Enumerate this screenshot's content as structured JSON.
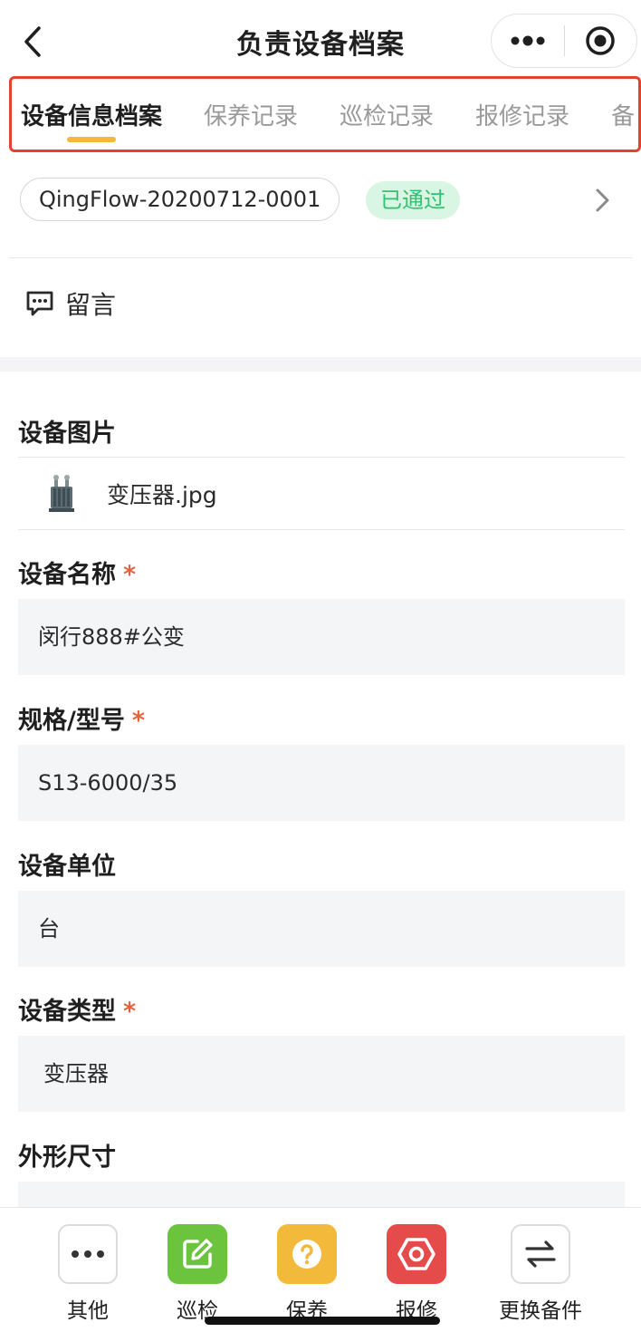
{
  "header": {
    "title": "负责设备档案"
  },
  "tabs": [
    {
      "label": "设备信息档案",
      "active": true
    },
    {
      "label": "保养记录",
      "active": false
    },
    {
      "label": "巡检记录",
      "active": false
    },
    {
      "label": "报修记录",
      "active": false
    },
    {
      "label": "备",
      "active": false
    }
  ],
  "record": {
    "id": "QingFlow-20200712-0001",
    "status": "已通过"
  },
  "comment": {
    "label": "留言"
  },
  "form": {
    "image_title": "设备图片",
    "image_file": "变压器.jpg",
    "name_title": "设备名称",
    "name_value": "闵行888#公变",
    "spec_title": "规格/型号",
    "spec_value": "S13-6000/35",
    "unit_title": "设备单位",
    "unit_value": "台",
    "type_title": "设备类型",
    "type_value": "变压器",
    "size_title": "外形尺寸",
    "size_value": "",
    "required_mark": "*"
  },
  "bottom_bar": {
    "other": "其他",
    "patrol": "巡检",
    "maintain": "保养",
    "repair": "报修",
    "replace": "更换备件"
  },
  "colors": {
    "tab_indicator": "#f2b93b",
    "highlight_border": "#e0432f",
    "status_text": "#33c172",
    "status_bg": "#d9f5e4",
    "required": "#e2643f",
    "patrol_icon_bg": "#6cc43e",
    "maintain_icon_bg": "#f2b93b",
    "repair_icon_bg": "#e64b4b"
  }
}
